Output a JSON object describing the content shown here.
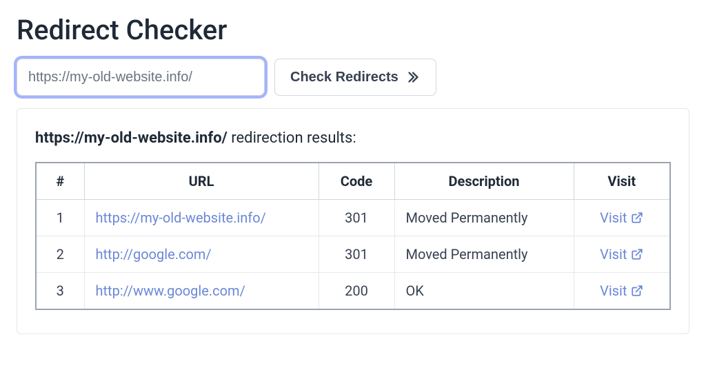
{
  "page_title": "Redirect Checker",
  "input": {
    "value": "https://my-old-website.info/",
    "placeholder": ""
  },
  "check_button_label": "Check Redirects",
  "results": {
    "heading_bold": "https://my-old-website.info/",
    "heading_rest": " redirection results:",
    "columns": {
      "num": "#",
      "url": "URL",
      "code": "Code",
      "desc": "Description",
      "visit": "Visit"
    },
    "visit_label": "Visit",
    "rows": [
      {
        "num": "1",
        "url": "https://my-old-website.info/",
        "code": "301",
        "desc": "Moved Permanently"
      },
      {
        "num": "2",
        "url": "http://google.com/",
        "code": "301",
        "desc": "Moved Permanently"
      },
      {
        "num": "3",
        "url": "http://www.google.com/",
        "code": "200",
        "desc": "OK"
      }
    ]
  }
}
